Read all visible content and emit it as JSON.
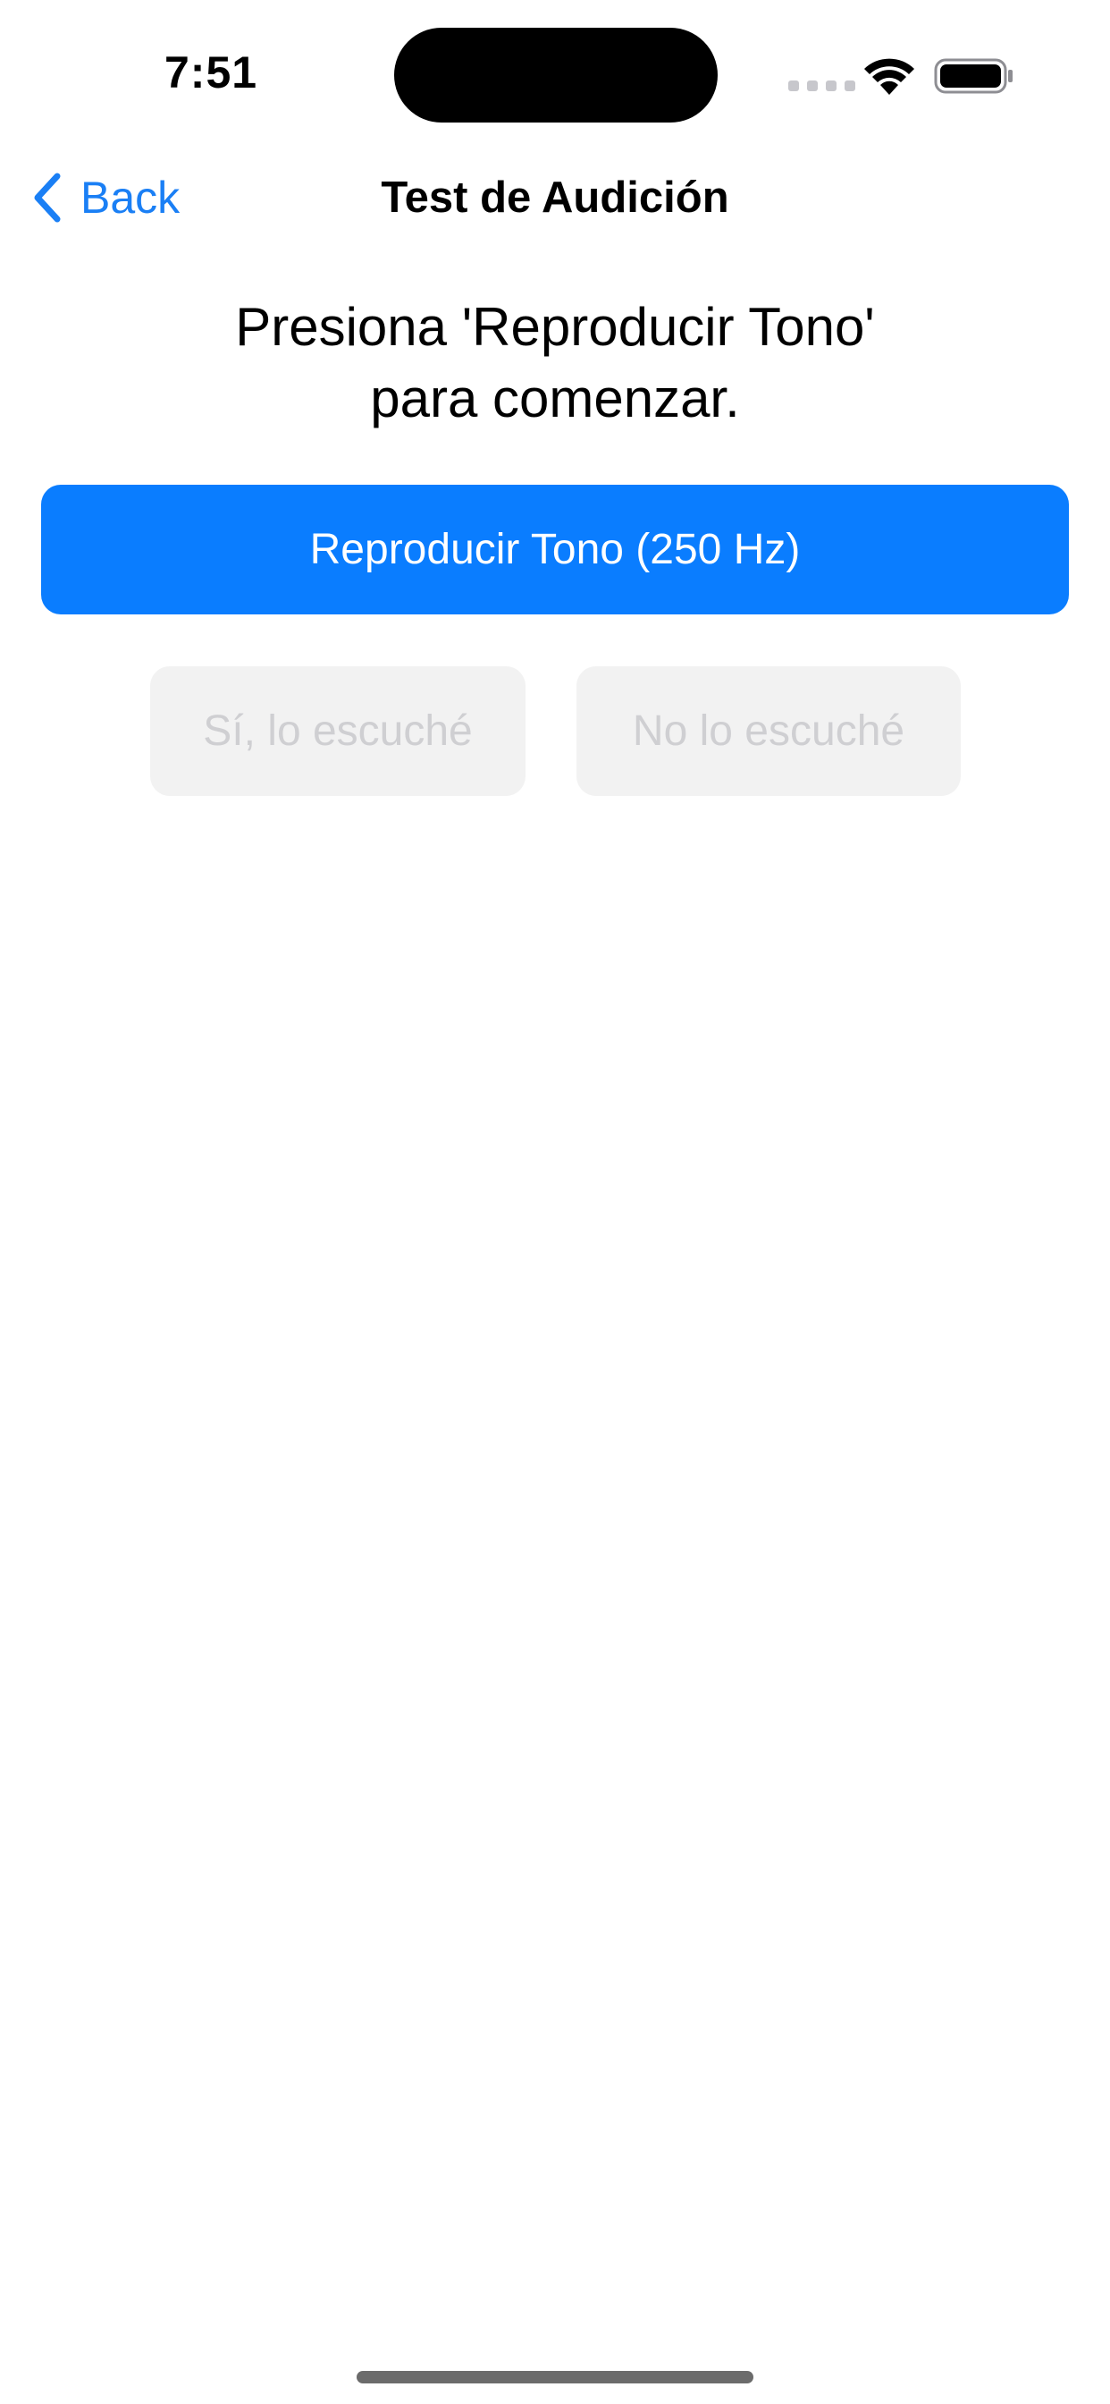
{
  "status_bar": {
    "time": "7:51",
    "icons": [
      "cellular-signal-icon",
      "wifi-icon",
      "battery-icon"
    ]
  },
  "nav": {
    "back_label": "Back",
    "title": "Test de Audición"
  },
  "instruction": {
    "line1": "Presiona 'Reproducir Tono'",
    "line2": "para comenzar."
  },
  "buttons": {
    "play_tone": "Reproducir Tono (250 Hz)",
    "heard_yes": "Sí, lo escuché",
    "heard_no": "No lo escuché"
  },
  "colors": {
    "accent": "#0a7dff",
    "back_link": "#1a7ff5",
    "disabled_bg": "#f2f2f2",
    "disabled_text": "#cfcfd2"
  }
}
